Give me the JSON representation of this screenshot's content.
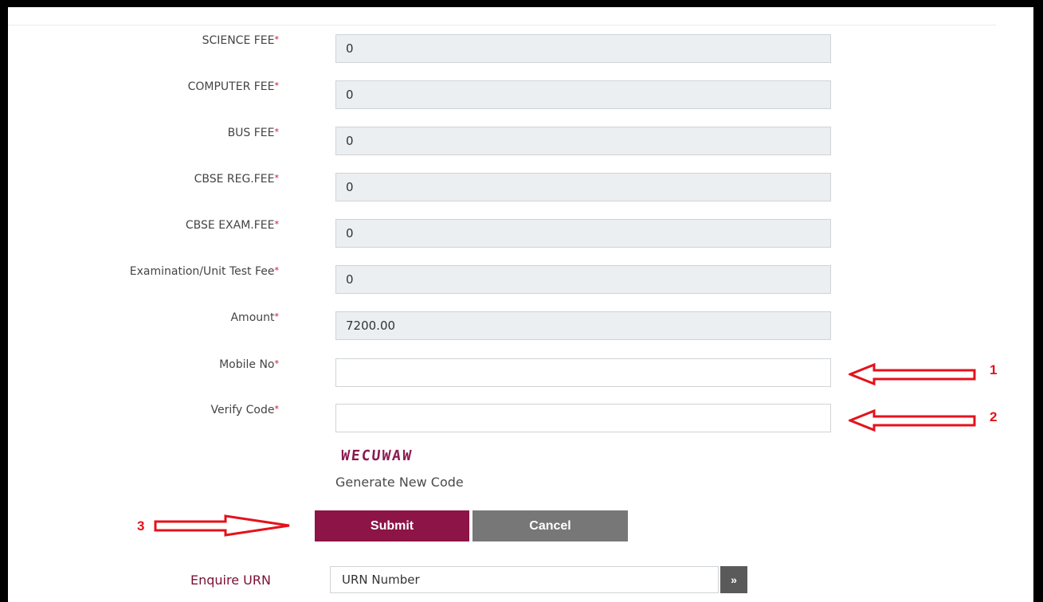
{
  "form": {
    "required_mark": "*",
    "fields": [
      {
        "label": "SCIENCE FEE",
        "value": "0"
      },
      {
        "label": "COMPUTER FEE",
        "value": "0"
      },
      {
        "label": "BUS FEE",
        "value": "0"
      },
      {
        "label": "CBSE REG.FEE",
        "value": "0"
      },
      {
        "label": "CBSE EXAM.FEE",
        "value": "0"
      },
      {
        "label": "Examination/Unit Test Fee",
        "value": "0"
      },
      {
        "label": "Amount",
        "value": "7200.00"
      }
    ],
    "mobile": {
      "label": "Mobile No",
      "value": ""
    },
    "verify": {
      "label": "Verify Code",
      "value": ""
    },
    "captcha_text": "WECUWAW",
    "generate_link": "Generate New Code",
    "submit_label": "Submit",
    "cancel_label": "Cancel"
  },
  "enquire": {
    "label": "Enquire URN",
    "placeholder": "URN Number",
    "go_glyph": "»"
  },
  "annotations": {
    "arrow1": "1",
    "arrow2": "2",
    "arrow3": "3",
    "color": "#e4121b"
  }
}
